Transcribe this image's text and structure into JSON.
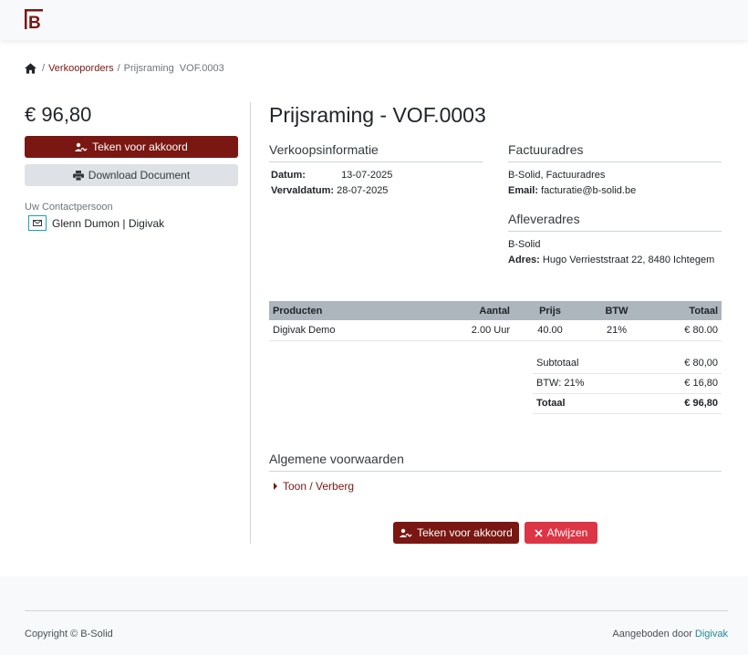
{
  "colors": {
    "brand": "#7a1712",
    "danger": "#dc3545",
    "link_teal": "#20889a"
  },
  "breadcrumb": {
    "home_icon": "home-icon",
    "sep": "/",
    "link": "Verkooporders",
    "current": "Prijsraming  VOF.0003"
  },
  "sidebar": {
    "price": "€ 96,80",
    "sign_label": "Teken voor akkoord",
    "download_label": "Download Document",
    "contact_label": "Uw Contactpersoon",
    "contact_name": "Glenn Dumon | Digivak"
  },
  "main": {
    "title": "Prijsraming - VOF.0003",
    "sales_info": {
      "heading": "Verkoopsinformatie",
      "date_label": "Datum:",
      "date_value": "13-07-2025",
      "due_label": "Vervaldatum:",
      "due_value": "28-07-2025"
    },
    "billing": {
      "heading": "Factuuradres",
      "line1": "B-Solid, Factuuradres",
      "email_label": "Email:",
      "email_value": "facturatie@b-solid.be"
    },
    "delivery": {
      "heading": "Afleveradres",
      "line1": "B-Solid",
      "address_label": "Adres:",
      "address_value": "Hugo Verrieststraat 22, 8480 Ichtegem"
    },
    "products": {
      "headers": [
        "Producten",
        "Aantal",
        "Prijs",
        "BTW",
        "Totaal"
      ],
      "rows": [
        [
          "Digivak Demo",
          "2.00 Uur",
          "40.00",
          "21%",
          "€ 80.00"
        ]
      ]
    },
    "totals": {
      "subtotal_label": "Subtotaal",
      "subtotal_value": "€ 80,00",
      "vat_label": "BTW: 21%",
      "vat_value": "€ 16,80",
      "total_label": "Totaal",
      "total_value": "€ 96,80"
    },
    "terms": {
      "heading": "Algemene voorwaarden",
      "toggle": "Toon / Verberg"
    },
    "actions": {
      "accept": "Teken voor akkoord",
      "reject": "Afwijzen"
    }
  },
  "footer": {
    "copyright": "Copyright © B-Solid",
    "offered_by": "Aangeboden door",
    "brand": "Digivak"
  }
}
